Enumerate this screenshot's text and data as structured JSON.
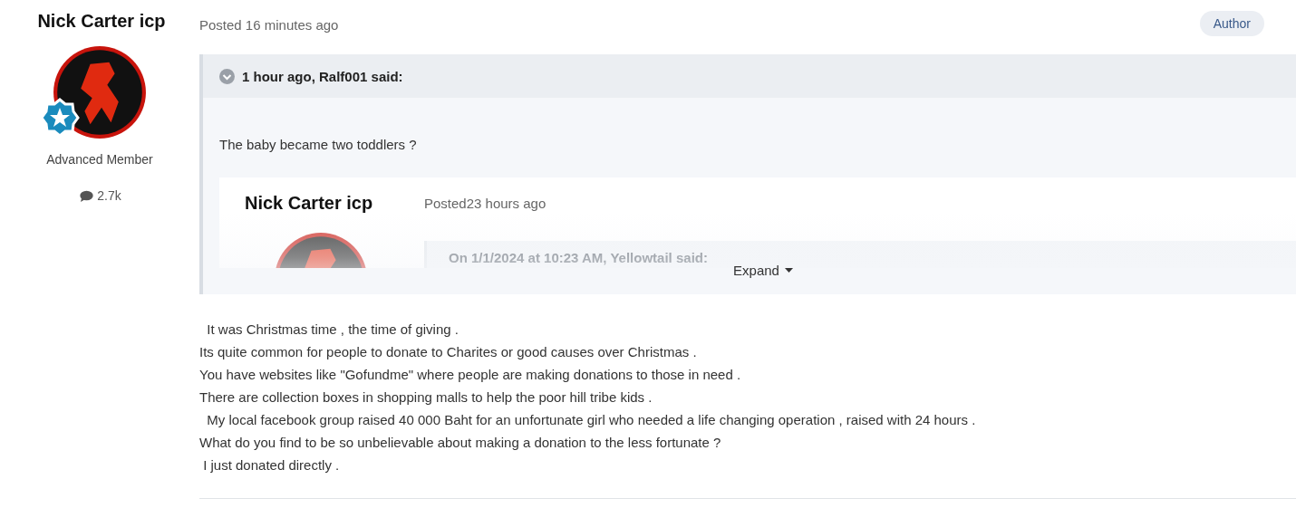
{
  "author": {
    "name": "Nick Carter icp",
    "rank": "Advanced Member",
    "post_count": "2.7k"
  },
  "post": {
    "posted": "Posted 16 minutes ago",
    "badge": "Author",
    "quote": {
      "citation": "1 hour ago, Ralf001 said:",
      "text": "The baby became two toddlers ?",
      "nested_post": {
        "author": "Nick Carter icp",
        "posted": "Posted23 hours ago",
        "quote_citation": "On 1/1/2024 at 10:23 AM, Yellowtail said:"
      },
      "expand": "Expand"
    },
    "body": [
      "  It was Christmas time , the time of giving .",
      "Its quite common for people to donate to Charites or good causes over Christmas .",
      "You have websites like \"Gofundme\" where people are making donations to those in need .",
      "There are collection boxes in shopping malls to help the poor hill tribe kids .",
      "  My local facebook group raised 40 000 Baht for an unfortunate girl who needed a life changing operation , raised with 24 hours .",
      "What do you find to be so unbelievable about making a donation to the less fortunate ?",
      " I just donated directly ."
    ]
  }
}
